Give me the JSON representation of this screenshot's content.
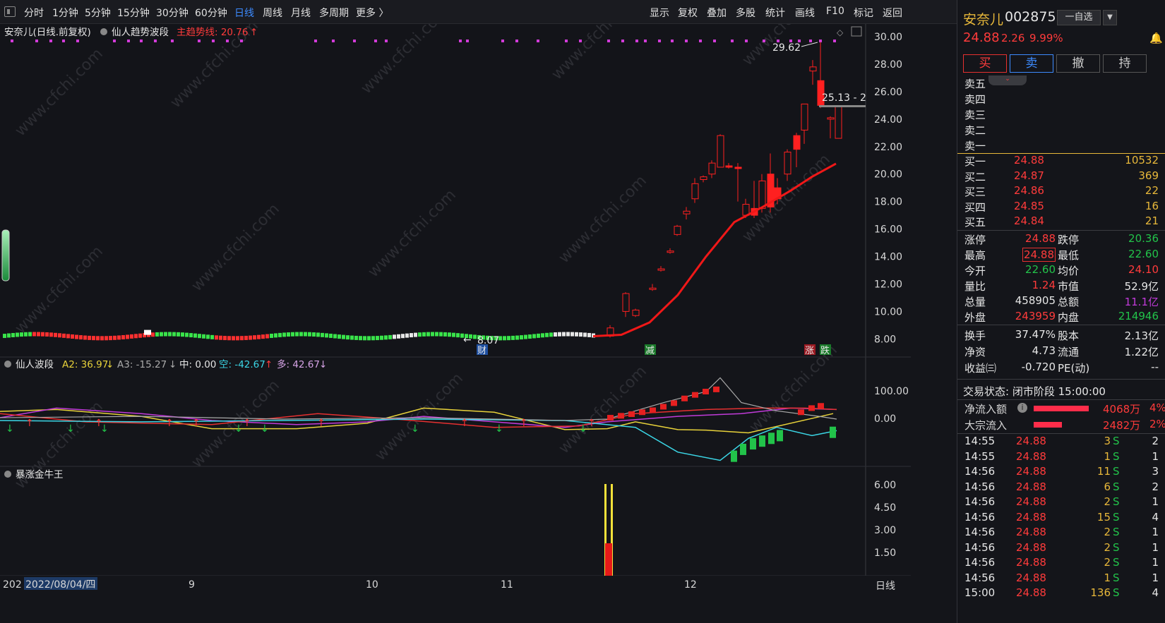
{
  "toolbar": {
    "periods": [
      "分时",
      "1分钟",
      "5分钟",
      "15分钟",
      "30分钟",
      "60分钟",
      "日线",
      "周线",
      "月线",
      "多周期",
      "更多 〉"
    ],
    "actions": [
      "显示",
      "复权",
      "叠加",
      "多股",
      "统计",
      "画线",
      "F10",
      "标记",
      "返回"
    ]
  },
  "main_chart": {
    "header_title": "安奈儿(日线.前复权)",
    "indicator_name": "仙人趋势波段",
    "trend_label": "主趋势线: 20.76",
    "trend_arrow": "↑",
    "price_ticks": [
      "30.00",
      "28.00",
      "26.00",
      "24.00",
      "22.00",
      "20.00",
      "18.00",
      "16.00",
      "14.00",
      "12.00",
      "10.00",
      "8.00"
    ],
    "annot_high": "29.62",
    "annot_low": "8.07",
    "annot_current": "25.13 - 2",
    "tags": [
      "财",
      "减",
      "涨",
      "跌"
    ]
  },
  "wave_panel": {
    "name": "仙人波段",
    "a2_label": "A2: 36.97",
    "a3_label": "A3: -15.27",
    "mid_label": "中: 0.00",
    "kong_label": "空: -42.67",
    "duo_label": "多: 42.67",
    "ticks": [
      "100.00",
      "0.00"
    ]
  },
  "bull_panel": {
    "name": "暴涨金牛王",
    "ticks": [
      "6.00",
      "4.50",
      "3.00",
      "1.50"
    ]
  },
  "xaxis": {
    "labels": [
      "202",
      "2022/08/04/四",
      "9",
      "10",
      "11",
      "12"
    ],
    "period": "日线"
  },
  "watermark": "www.cfchi.com",
  "stock": {
    "name": "安奈儿",
    "code": "002875",
    "watch_label": "一自选",
    "price": "24.88",
    "change": "2.26",
    "pct": "9.99%"
  },
  "trade_buttons": [
    "买",
    "卖",
    "撤",
    "持"
  ],
  "asks": [
    {
      "label": "卖五"
    },
    {
      "label": "卖四"
    },
    {
      "label": "卖三"
    },
    {
      "label": "卖二"
    },
    {
      "label": "卖一"
    }
  ],
  "bids": [
    {
      "label": "买一",
      "price": "24.88",
      "vol": "10532"
    },
    {
      "label": "买二",
      "price": "24.87",
      "vol": "369"
    },
    {
      "label": "买三",
      "price": "24.86",
      "vol": "22"
    },
    {
      "label": "买四",
      "price": "24.85",
      "vol": "16"
    },
    {
      "label": "买五",
      "price": "24.84",
      "vol": "21"
    }
  ],
  "stats": [
    {
      "k1": "涨停",
      "v1": "24.88",
      "k2": "跌停",
      "v2": "20.36"
    },
    {
      "k1": "最高",
      "v1": "24.88",
      "k2": "最低",
      "v2": "22.60"
    },
    {
      "k1": "今开",
      "v1": "22.60",
      "k2": "均价",
      "v2": "24.10"
    },
    {
      "k1": "量比",
      "v1": "1.24",
      "k2": "市值",
      "v2": "52.9亿"
    },
    {
      "k1": "总量",
      "v1": "458905",
      "k2": "总额",
      "v2": "11.1亿"
    },
    {
      "k1": "外盘",
      "v1": "243959",
      "k2": "内盘",
      "v2": "214946"
    },
    {
      "k1": "换手",
      "v1": "37.47%",
      "k2": "股本",
      "v2": "2.13亿"
    },
    {
      "k1": "净资",
      "v1": "4.73",
      "k2": "流通",
      "v2": "1.22亿"
    },
    {
      "k1": "收益㈢",
      "v1": "-0.720",
      "k2": "PE(动)",
      "v2": "--"
    }
  ],
  "trade_status": "交易状态: 闭市阶段 15:00:00",
  "flows": [
    {
      "label": "净流入额",
      "value": "4068万",
      "pct": "4%"
    },
    {
      "label": "大宗流入",
      "value": "2482万",
      "pct": "2%"
    }
  ],
  "ticks": [
    {
      "time": "14:55",
      "price": "24.88",
      "vol": "3",
      "side": "S",
      "n": "2"
    },
    {
      "time": "14:55",
      "price": "24.88",
      "vol": "1",
      "side": "S",
      "n": "1"
    },
    {
      "time": "14:56",
      "price": "24.88",
      "vol": "11",
      "side": "S",
      "n": "3"
    },
    {
      "time": "14:56",
      "price": "24.88",
      "vol": "6",
      "side": "S",
      "n": "2"
    },
    {
      "time": "14:56",
      "price": "24.88",
      "vol": "2",
      "side": "S",
      "n": "1"
    },
    {
      "time": "14:56",
      "price": "24.88",
      "vol": "15",
      "side": "S",
      "n": "4"
    },
    {
      "time": "14:56",
      "price": "24.88",
      "vol": "2",
      "side": "S",
      "n": "1"
    },
    {
      "time": "14:56",
      "price": "24.88",
      "vol": "2",
      "side": "S",
      "n": "1"
    },
    {
      "time": "14:56",
      "price": "24.88",
      "vol": "2",
      "side": "S",
      "n": "1"
    },
    {
      "time": "14:56",
      "price": "24.88",
      "vol": "1",
      "side": "S",
      "n": "1"
    },
    {
      "time": "15:00",
      "price": "24.88",
      "vol": "136",
      "side": "S",
      "n": "4"
    }
  ]
}
